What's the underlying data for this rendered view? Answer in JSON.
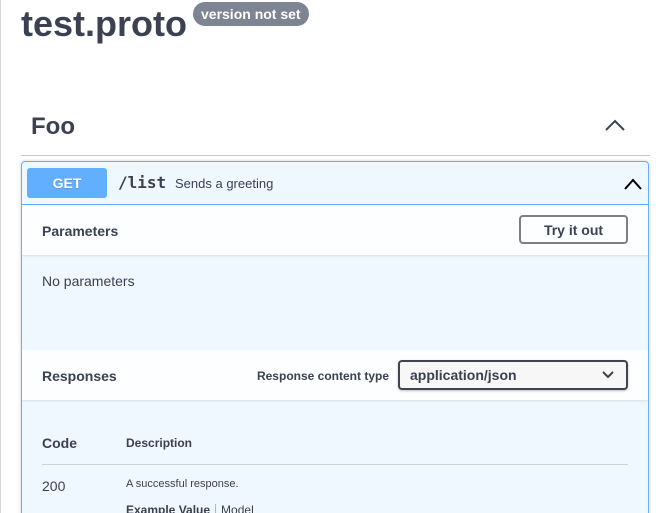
{
  "header": {
    "title": "test.proto",
    "version_badge": "version not set"
  },
  "tag": {
    "name": "Foo",
    "toggle_icon": "chevron-up-icon"
  },
  "operation": {
    "method": "GET",
    "path": "/list",
    "summary": "Sends a greeting",
    "accent_color": "#61affe"
  },
  "parameters": {
    "title": "Parameters",
    "try_button": "Try it out",
    "empty_text": "No parameters"
  },
  "responses": {
    "title": "Responses",
    "content_type_label": "Response content type",
    "content_type_value": "application/json",
    "columns": {
      "code": "Code",
      "description": "Description"
    },
    "rows": [
      {
        "code": "200",
        "description": "A successful response.",
        "tabs": [
          "Example Value",
          "Model"
        ]
      }
    ]
  }
}
